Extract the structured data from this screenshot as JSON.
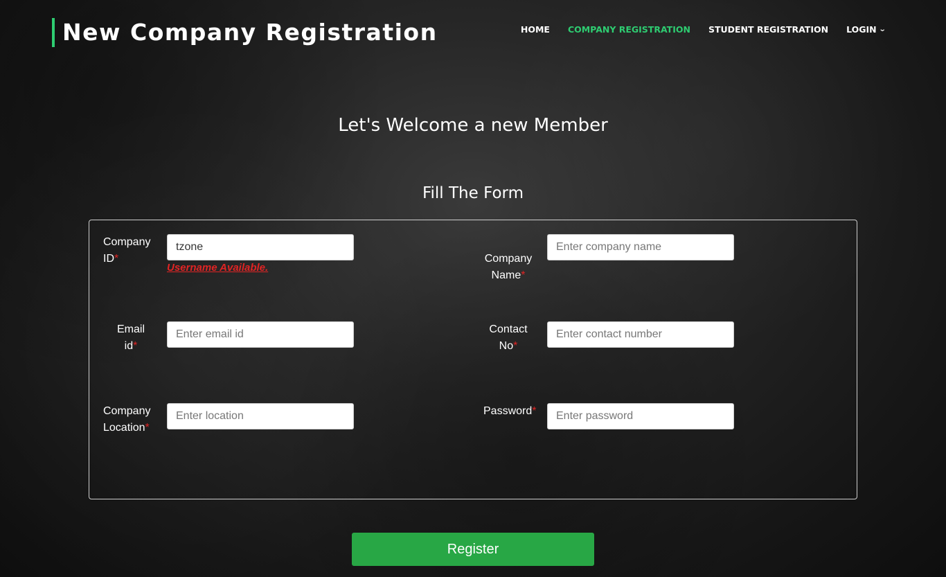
{
  "header": {
    "title": "New Company Registration",
    "nav": [
      {
        "label": "HOME",
        "active": false
      },
      {
        "label": "COMPANY REGISTRATION",
        "active": true
      },
      {
        "label": "STUDENT REGISTRATION",
        "active": false
      },
      {
        "label": "LOGIN",
        "active": false,
        "dropdown": true
      }
    ]
  },
  "main": {
    "welcome": "Let's Welcome a new Member",
    "form_title": "Fill The Form"
  },
  "form": {
    "company_id": {
      "label_line1": "Company",
      "label_line2": "ID",
      "value": "tzone",
      "status": "Username Available."
    },
    "company_name": {
      "label_line1": "Company",
      "label_line2": "Name",
      "placeholder": "Enter company name"
    },
    "email": {
      "label_line1": "Email",
      "label_line2": "id",
      "placeholder": "Enter email id"
    },
    "contact": {
      "label_line1": "Contact",
      "label_line2": "No",
      "placeholder": "Enter contact number"
    },
    "location": {
      "label_line1": "Company",
      "label_line2": "Location",
      "placeholder": "Enter location"
    },
    "password": {
      "label": "Password",
      "placeholder": "Enter password"
    },
    "required_mark": "*"
  },
  "register_button": "Register",
  "colors": {
    "accent": "#2ecc71",
    "button": "#28a745",
    "required": "#e02424"
  }
}
